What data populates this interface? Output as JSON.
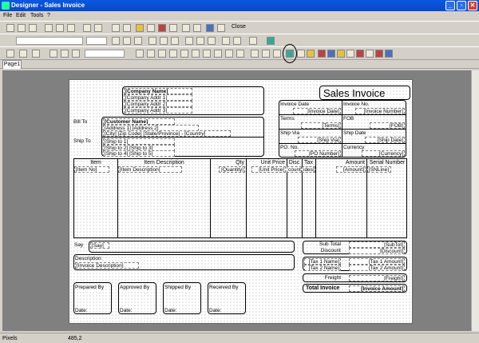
{
  "window": {
    "title": "Designer - Sales Invoice",
    "buttons": {
      "min": "_",
      "max": "▫",
      "close": "✕"
    }
  },
  "menu": {
    "file": "File",
    "edit": "Edit",
    "tools": "Tools",
    "help": "?"
  },
  "toolbar": {
    "close_label": "Close"
  },
  "tabs": {
    "page1": "Page1"
  },
  "status": {
    "units": "Pixels",
    "position": "485,2"
  },
  "report": {
    "title": "Sales Invoice",
    "company": {
      "name": "[Company Name]",
      "addr1": "[Company Addr 1]",
      "addr2": "[Company Addr 2]",
      "addr3": "[Company Addr 3]"
    },
    "bill_to_label": "Bill To",
    "customer": {
      "name": "[Customer Name]",
      "address": "[Address 1] [Address 2]",
      "city": "[City] [Zip Code] [State/Province] - [Country]"
    },
    "ship_to_label": "Ship To",
    "ship": {
      "line1": "[Ship to 1]",
      "line2": "[Ship to 2] [Ship to 3]",
      "line3": "[Ship to 4] [Ship to 5]"
    },
    "info": {
      "invoice_date_label": "Invoice Date",
      "invoice_date": "[Invoice Date]",
      "invoice_no_label": "Invoice No.",
      "invoice_no": "[Invoice Number]",
      "terms_label": "Terms",
      "terms": "[Terms]",
      "fob_label": "FOB",
      "fob": "[FOB]",
      "ship_via_label": "Ship Via",
      "ship_via": "[Ship Via]",
      "ship_date_label": "Ship Date",
      "ship_date": "[Ship Date]",
      "po_label": "PO. No.",
      "po": "[PO Number]",
      "currency_label": "Currency",
      "currency": "[Currency]"
    },
    "columns": {
      "item": "Item",
      "item_field": "[Item No]",
      "desc": "Item Description",
      "desc_field": "[Item Description]",
      "qty": "Qty",
      "qty_field": "[Quantity]",
      "unit_price": "Unit Price",
      "unit_price_field": "[Unit Price]",
      "disc": "Disc",
      "disc_field": "count]",
      "tax": "Tax",
      "tax_field": "ides]",
      "amount": "Amount",
      "amount_field": "[Amount]",
      "serial": "Serial Number",
      "serial_field": "[SNLine]"
    },
    "say_label": "Say",
    "say_field": "[Say]",
    "description_label": "Description:",
    "description_field": "[Invoice Description]",
    "totals": {
      "subtotal_label": "Sub Total",
      "subtotal": "[SubTot]",
      "discount_label": "Discount",
      "discount": "[Discount]",
      "tax1_name": "[Tax 1 Name]",
      "tax1_amount": "[Tax 1 Amount]",
      "tax2_name": "[Tax 2 Name]",
      "tax2_amount": "[Tax 2 Amount]",
      "freight_label": "Freight",
      "freight": "[Freight]",
      "total_label": "Total Invoice",
      "total": "[Invoice Amount]"
    },
    "signatures": {
      "prepared": "Prepared By",
      "approved": "Approved By",
      "shipped": "Shipped By",
      "received": "Received By",
      "date": "Date:"
    }
  }
}
